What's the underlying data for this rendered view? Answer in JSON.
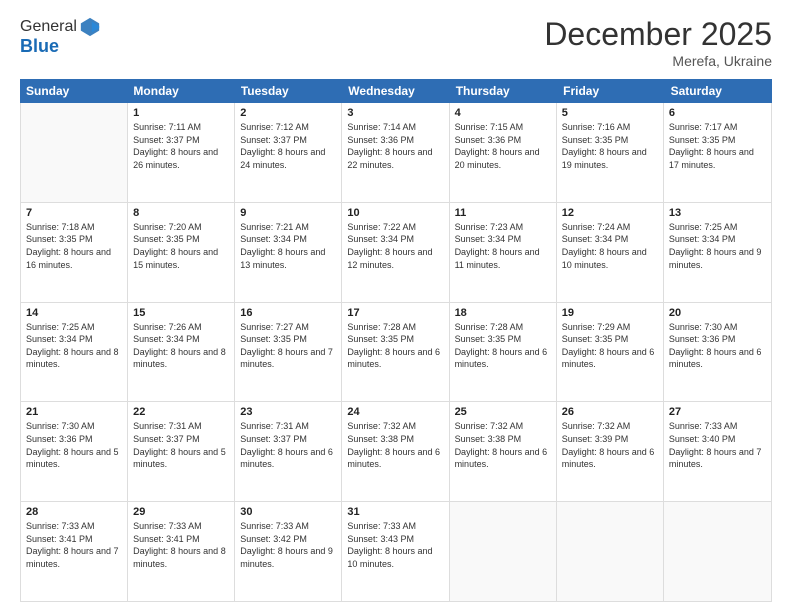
{
  "header": {
    "logo_line1": "General",
    "logo_line2": "Blue",
    "month": "December 2025",
    "location": "Merefa, Ukraine"
  },
  "days": [
    "Sunday",
    "Monday",
    "Tuesday",
    "Wednesday",
    "Thursday",
    "Friday",
    "Saturday"
  ],
  "weeks": [
    [
      {
        "day": "",
        "sunrise": "",
        "sunset": "",
        "daylight": ""
      },
      {
        "day": "1",
        "sunrise": "Sunrise: 7:11 AM",
        "sunset": "Sunset: 3:37 PM",
        "daylight": "Daylight: 8 hours and 26 minutes."
      },
      {
        "day": "2",
        "sunrise": "Sunrise: 7:12 AM",
        "sunset": "Sunset: 3:37 PM",
        "daylight": "Daylight: 8 hours and 24 minutes."
      },
      {
        "day": "3",
        "sunrise": "Sunrise: 7:14 AM",
        "sunset": "Sunset: 3:36 PM",
        "daylight": "Daylight: 8 hours and 22 minutes."
      },
      {
        "day": "4",
        "sunrise": "Sunrise: 7:15 AM",
        "sunset": "Sunset: 3:36 PM",
        "daylight": "Daylight: 8 hours and 20 minutes."
      },
      {
        "day": "5",
        "sunrise": "Sunrise: 7:16 AM",
        "sunset": "Sunset: 3:35 PM",
        "daylight": "Daylight: 8 hours and 19 minutes."
      },
      {
        "day": "6",
        "sunrise": "Sunrise: 7:17 AM",
        "sunset": "Sunset: 3:35 PM",
        "daylight": "Daylight: 8 hours and 17 minutes."
      }
    ],
    [
      {
        "day": "7",
        "sunrise": "Sunrise: 7:18 AM",
        "sunset": "Sunset: 3:35 PM",
        "daylight": "Daylight: 8 hours and 16 minutes."
      },
      {
        "day": "8",
        "sunrise": "Sunrise: 7:20 AM",
        "sunset": "Sunset: 3:35 PM",
        "daylight": "Daylight: 8 hours and 15 minutes."
      },
      {
        "day": "9",
        "sunrise": "Sunrise: 7:21 AM",
        "sunset": "Sunset: 3:34 PM",
        "daylight": "Daylight: 8 hours and 13 minutes."
      },
      {
        "day": "10",
        "sunrise": "Sunrise: 7:22 AM",
        "sunset": "Sunset: 3:34 PM",
        "daylight": "Daylight: 8 hours and 12 minutes."
      },
      {
        "day": "11",
        "sunrise": "Sunrise: 7:23 AM",
        "sunset": "Sunset: 3:34 PM",
        "daylight": "Daylight: 8 hours and 11 minutes."
      },
      {
        "day": "12",
        "sunrise": "Sunrise: 7:24 AM",
        "sunset": "Sunset: 3:34 PM",
        "daylight": "Daylight: 8 hours and 10 minutes."
      },
      {
        "day": "13",
        "sunrise": "Sunrise: 7:25 AM",
        "sunset": "Sunset: 3:34 PM",
        "daylight": "Daylight: 8 hours and 9 minutes."
      }
    ],
    [
      {
        "day": "14",
        "sunrise": "Sunrise: 7:25 AM",
        "sunset": "Sunset: 3:34 PM",
        "daylight": "Daylight: 8 hours and 8 minutes."
      },
      {
        "day": "15",
        "sunrise": "Sunrise: 7:26 AM",
        "sunset": "Sunset: 3:34 PM",
        "daylight": "Daylight: 8 hours and 8 minutes."
      },
      {
        "day": "16",
        "sunrise": "Sunrise: 7:27 AM",
        "sunset": "Sunset: 3:35 PM",
        "daylight": "Daylight: 8 hours and 7 minutes."
      },
      {
        "day": "17",
        "sunrise": "Sunrise: 7:28 AM",
        "sunset": "Sunset: 3:35 PM",
        "daylight": "Daylight: 8 hours and 6 minutes."
      },
      {
        "day": "18",
        "sunrise": "Sunrise: 7:28 AM",
        "sunset": "Sunset: 3:35 PM",
        "daylight": "Daylight: 8 hours and 6 minutes."
      },
      {
        "day": "19",
        "sunrise": "Sunrise: 7:29 AM",
        "sunset": "Sunset: 3:35 PM",
        "daylight": "Daylight: 8 hours and 6 minutes."
      },
      {
        "day": "20",
        "sunrise": "Sunrise: 7:30 AM",
        "sunset": "Sunset: 3:36 PM",
        "daylight": "Daylight: 8 hours and 6 minutes."
      }
    ],
    [
      {
        "day": "21",
        "sunrise": "Sunrise: 7:30 AM",
        "sunset": "Sunset: 3:36 PM",
        "daylight": "Daylight: 8 hours and 5 minutes."
      },
      {
        "day": "22",
        "sunrise": "Sunrise: 7:31 AM",
        "sunset": "Sunset: 3:37 PM",
        "daylight": "Daylight: 8 hours and 5 minutes."
      },
      {
        "day": "23",
        "sunrise": "Sunrise: 7:31 AM",
        "sunset": "Sunset: 3:37 PM",
        "daylight": "Daylight: 8 hours and 6 minutes."
      },
      {
        "day": "24",
        "sunrise": "Sunrise: 7:32 AM",
        "sunset": "Sunset: 3:38 PM",
        "daylight": "Daylight: 8 hours and 6 minutes."
      },
      {
        "day": "25",
        "sunrise": "Sunrise: 7:32 AM",
        "sunset": "Sunset: 3:38 PM",
        "daylight": "Daylight: 8 hours and 6 minutes."
      },
      {
        "day": "26",
        "sunrise": "Sunrise: 7:32 AM",
        "sunset": "Sunset: 3:39 PM",
        "daylight": "Daylight: 8 hours and 6 minutes."
      },
      {
        "day": "27",
        "sunrise": "Sunrise: 7:33 AM",
        "sunset": "Sunset: 3:40 PM",
        "daylight": "Daylight: 8 hours and 7 minutes."
      }
    ],
    [
      {
        "day": "28",
        "sunrise": "Sunrise: 7:33 AM",
        "sunset": "Sunset: 3:41 PM",
        "daylight": "Daylight: 8 hours and 7 minutes."
      },
      {
        "day": "29",
        "sunrise": "Sunrise: 7:33 AM",
        "sunset": "Sunset: 3:41 PM",
        "daylight": "Daylight: 8 hours and 8 minutes."
      },
      {
        "day": "30",
        "sunrise": "Sunrise: 7:33 AM",
        "sunset": "Sunset: 3:42 PM",
        "daylight": "Daylight: 8 hours and 9 minutes."
      },
      {
        "day": "31",
        "sunrise": "Sunrise: 7:33 AM",
        "sunset": "Sunset: 3:43 PM",
        "daylight": "Daylight: 8 hours and 10 minutes."
      },
      {
        "day": "",
        "sunrise": "",
        "sunset": "",
        "daylight": ""
      },
      {
        "day": "",
        "sunrise": "",
        "sunset": "",
        "daylight": ""
      },
      {
        "day": "",
        "sunrise": "",
        "sunset": "",
        "daylight": ""
      }
    ]
  ]
}
